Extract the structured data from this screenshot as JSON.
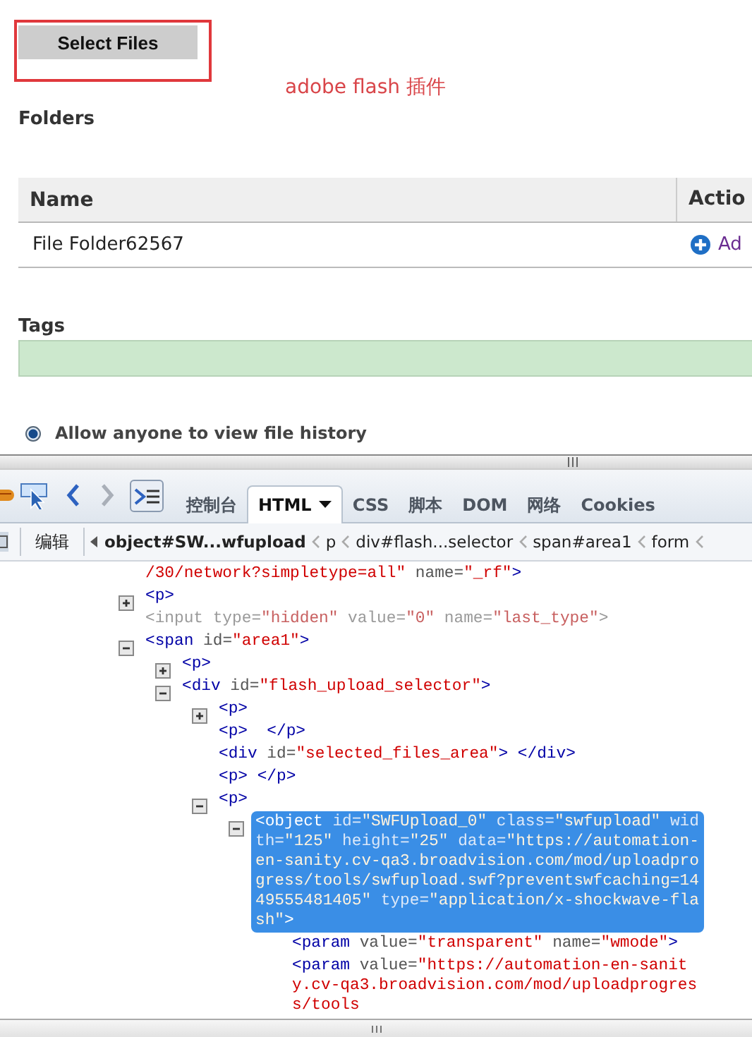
{
  "page": {
    "select_button": "Select Files",
    "annotation": "adobe flash 插件",
    "folders_heading": "Folders",
    "table": {
      "columns": [
        "Name",
        "Actio"
      ],
      "rows": [
        {
          "name": "File Folder62567",
          "action": "Ad"
        }
      ]
    },
    "tags_heading": "Tags",
    "history_option": {
      "label": "Allow anyone to view file history",
      "selected": true
    }
  },
  "devtools": {
    "nav_buttons": [
      {
        "kind": "back",
        "disabled": false
      },
      {
        "kind": "forward",
        "disabled": true
      }
    ],
    "command_toggle": {
      "on": true
    },
    "tabs": [
      {
        "label": "控制台",
        "selected": false,
        "has_menu": false
      },
      {
        "label": "HTML",
        "selected": true,
        "has_menu": true
      },
      {
        "label": "CSS",
        "selected": false,
        "has_menu": false
      },
      {
        "label": "脚本",
        "selected": false,
        "has_menu": false
      },
      {
        "label": "DOM",
        "selected": false,
        "has_menu": false
      },
      {
        "label": "网络",
        "selected": false,
        "has_menu": false
      },
      {
        "label": "Cookies",
        "selected": false,
        "has_menu": false
      }
    ],
    "edit_button": "编辑",
    "breadcrumbs": [
      {
        "label": "object#SW...wfupload",
        "selected": true
      },
      {
        "label": "p",
        "selected": false
      },
      {
        "label": "div#flash...selector",
        "selected": false
      },
      {
        "label": "span#area1",
        "selected": false
      },
      {
        "label": "form",
        "selected": false
      }
    ],
    "tree": [
      {
        "kind": "leaf",
        "selected": false,
        "greyed": false,
        "tokens": [
          {
            "kind": "value",
            "text": "/30/network?simpletype=all\""
          },
          {
            "kind": "attr",
            "text": " name="
          },
          {
            "kind": "value",
            "text": "\"_rf\""
          },
          {
            "kind": "tag",
            "text": ">"
          }
        ]
      },
      {
        "kind": "collapsed",
        "selected": false,
        "greyed": false,
        "tokens": [
          {
            "kind": "tag",
            "text": "<p>"
          }
        ]
      },
      {
        "kind": "leaf",
        "selected": false,
        "greyed": true,
        "tokens": [
          {
            "kind": "tag",
            "text": "<input"
          },
          {
            "kind": "attr",
            "text": " type="
          },
          {
            "kind": "value",
            "text": "\"hidden\""
          },
          {
            "kind": "attr",
            "text": " value="
          },
          {
            "kind": "value",
            "text": "\"0\""
          },
          {
            "kind": "attr",
            "text": " name="
          },
          {
            "kind": "value",
            "text": "\"last_type\""
          },
          {
            "kind": "tag",
            "text": ">"
          }
        ]
      },
      {
        "kind": "expanded",
        "selected": false,
        "greyed": false,
        "tokens": [
          {
            "kind": "tag",
            "text": "<span"
          },
          {
            "kind": "attr",
            "text": " id="
          },
          {
            "kind": "value",
            "text": "\"area1\""
          },
          {
            "kind": "tag",
            "text": ">"
          }
        ],
        "children": [
          {
            "kind": "collapsed",
            "selected": false,
            "greyed": false,
            "tokens": [
              {
                "kind": "tag",
                "text": "<p>"
              }
            ]
          },
          {
            "kind": "expanded",
            "selected": false,
            "greyed": false,
            "tokens": [
              {
                "kind": "tag",
                "text": "<div"
              },
              {
                "kind": "attr",
                "text": " id="
              },
              {
                "kind": "value",
                "text": "\"flash_upload_selector\""
              },
              {
                "kind": "tag",
                "text": ">"
              }
            ],
            "children": [
              {
                "kind": "collapsed",
                "selected": false,
                "greyed": false,
                "tokens": [
                  {
                    "kind": "tag",
                    "text": "<p>"
                  }
                ]
              },
              {
                "kind": "leaf",
                "selected": false,
                "greyed": false,
                "tokens": [
                  {
                    "kind": "tag",
                    "text": "<p>  </p>"
                  }
                ]
              },
              {
                "kind": "leaf",
                "selected": false,
                "greyed": false,
                "tokens": [
                  {
                    "kind": "tag",
                    "text": "<div"
                  },
                  {
                    "kind": "attr",
                    "text": " id="
                  },
                  {
                    "kind": "value",
                    "text": "\"selected_files_area\""
                  },
                  {
                    "kind": "tag",
                    "text": "> </div>"
                  }
                ]
              },
              {
                "kind": "leaf",
                "selected": false,
                "greyed": false,
                "tokens": [
                  {
                    "kind": "tag",
                    "text": "<p> </p>"
                  }
                ]
              },
              {
                "kind": "expanded",
                "selected": false,
                "greyed": false,
                "tokens": [
                  {
                    "kind": "tag",
                    "text": "<p>"
                  }
                ],
                "children": [
                  {
                    "kind": "expanded",
                    "selected": true,
                    "greyed": false,
                    "tokens": [
                      {
                        "kind": "tag",
                        "text": "<object"
                      },
                      {
                        "kind": "attr",
                        "text": " id="
                      },
                      {
                        "kind": "value",
                        "text": "\"SWFUpload_0\""
                      },
                      {
                        "kind": "attr",
                        "text": " class="
                      },
                      {
                        "kind": "value",
                        "text": "\"swfupload\""
                      },
                      {
                        "kind": "attr",
                        "text": " width="
                      },
                      {
                        "kind": "value",
                        "text": "\"125\""
                      },
                      {
                        "kind": "attr",
                        "text": " height="
                      },
                      {
                        "kind": "value",
                        "text": "\"25\""
                      },
                      {
                        "kind": "attr",
                        "text": " data="
                      },
                      {
                        "kind": "value",
                        "text": "\"https://automation-en-sanity.cv-qa3.broadvision.com/mod/uploadprogress/tools/swfupload.swf?preventswfcaching=1449555481405\""
                      },
                      {
                        "kind": "attr",
                        "text": " type="
                      },
                      {
                        "kind": "value",
                        "text": "\"application/x-shockwave-flash\""
                      },
                      {
                        "kind": "tag",
                        "text": ">"
                      }
                    ],
                    "children": [
                      {
                        "kind": "leaf",
                        "selected": false,
                        "greyed": false,
                        "tokens": [
                          {
                            "kind": "tag",
                            "text": "<param"
                          },
                          {
                            "kind": "attr",
                            "text": " value="
                          },
                          {
                            "kind": "value",
                            "text": "\"transparent\""
                          },
                          {
                            "kind": "attr",
                            "text": " name="
                          },
                          {
                            "kind": "value",
                            "text": "\"wmode\""
                          },
                          {
                            "kind": "tag",
                            "text": ">"
                          }
                        ]
                      },
                      {
                        "kind": "leaf",
                        "selected": false,
                        "greyed": false,
                        "tokens": [
                          {
                            "kind": "tag",
                            "text": "<param"
                          },
                          {
                            "kind": "attr",
                            "text": " value="
                          },
                          {
                            "kind": "value",
                            "text": "\"https://automation-en-sanity.cv-qa3.broadvision.com/mod/uploadprogress/tools"
                          }
                        ]
                      }
                    ]
                  }
                ]
              }
            ]
          }
        ]
      }
    ]
  }
}
